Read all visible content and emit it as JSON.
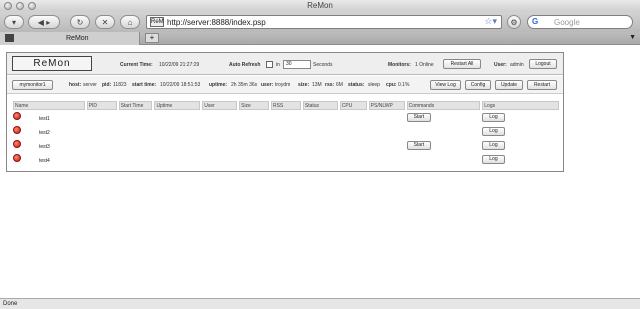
{
  "window": {
    "title": "ReMon"
  },
  "toolbar": {
    "url": "http://server:8888/index.psp",
    "url_glyph": "ReM",
    "search_placeholder": "Google",
    "google_letter": "G"
  },
  "tabs": [
    {
      "label": "ReMon"
    }
  ],
  "header": {
    "logo": "ReMon",
    "current_time_label": "Current Time:",
    "current_time_value": "10/22/09 21:27:29",
    "auto_refresh_label": "Auto Refresh",
    "in_label": "in",
    "refresh_seconds": "30",
    "seconds_label": "Seconds",
    "monitors_label": "Monitors:",
    "monitors_value": "1 Online",
    "restart_all_label": "Restart All",
    "user_label": "User:",
    "user_value": "admin",
    "logout_label": "Logout"
  },
  "monitor": {
    "name": "mymonitor1",
    "host_label": "host:",
    "host_value": "server",
    "pid_label": "pid:",
    "pid_value": "11823",
    "start_label": "start time:",
    "start_value": "10/22/09 18:51:53",
    "uptime_label": "uptime:",
    "uptime_value": "2h 35m 36s",
    "user_label": "user:",
    "user_value": "troydm",
    "size_label": "size:",
    "size_value": "13M",
    "rss_label": "rss:",
    "rss_value": "6M",
    "status_label": "status:",
    "status_value": "sleep",
    "cpu_label": "cpu:",
    "cpu_value": "0.1%",
    "buttons": {
      "view_log": "View Log",
      "config": "Config",
      "update": "Update",
      "restart": "Restart"
    }
  },
  "table": {
    "columns": [
      "Name",
      "PID",
      "Start Time",
      "Uptime",
      "User",
      "Size",
      "RSS",
      "Status",
      "CPU",
      "PS/NLWP",
      "Commands",
      "Logs"
    ],
    "rows": [
      {
        "name": "test1",
        "command": "Start",
        "log": "Log"
      },
      {
        "name": "test2",
        "command": "",
        "log": "Log"
      },
      {
        "name": "test3",
        "command": "Start",
        "log": "Log"
      },
      {
        "name": "test4",
        "command": "",
        "log": "Log"
      }
    ]
  },
  "status_bar": {
    "text": "Done"
  }
}
